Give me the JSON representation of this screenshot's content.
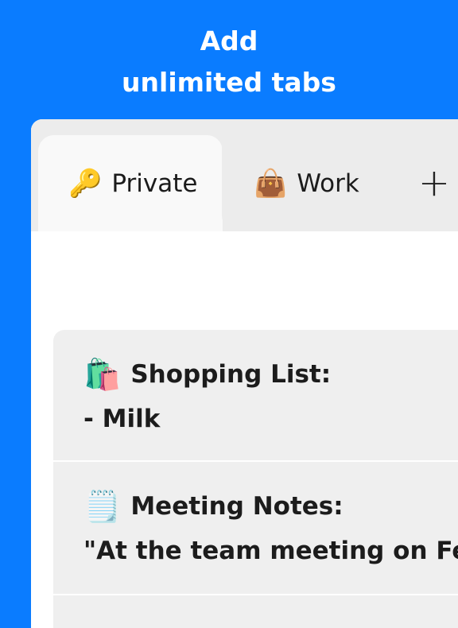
{
  "headline": {
    "line1": "Add",
    "line2": "unlimited tabs"
  },
  "tabs": [
    {
      "icon": "key-icon",
      "emoji": "🔑",
      "label": "Private",
      "active": true
    },
    {
      "icon": "handbag-icon",
      "emoji": "👜",
      "label": "Work",
      "active": false
    }
  ],
  "add_tab": {
    "icon": "plus-icon",
    "glyph": "+"
  },
  "notes": [
    {
      "icon": "shopping-bags-icon",
      "emoji": "🛍️",
      "title": "Shopping List:",
      "body": "- Milk"
    },
    {
      "icon": "notepad-icon",
      "emoji": "🗒️",
      "title": "Meeting Notes:",
      "body": "\"At the team meeting on Fe"
    }
  ],
  "colors": {
    "background": "#0a7cff",
    "tabbar": "#ececec",
    "active_tab": "#f9f9f9",
    "note_bg": "#efefef"
  }
}
